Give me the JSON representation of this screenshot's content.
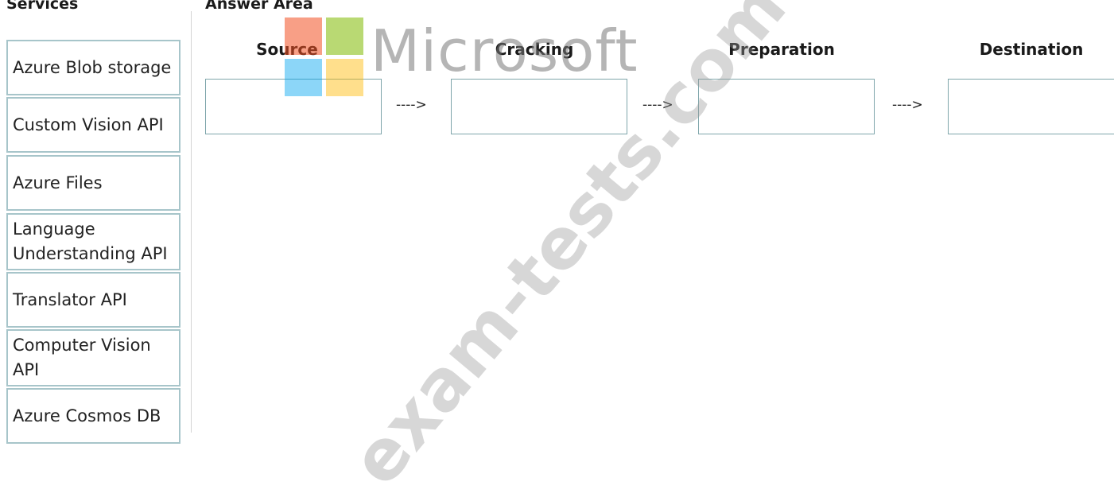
{
  "services": {
    "heading": "Services",
    "items": [
      {
        "label": "Azure Blob storage"
      },
      {
        "label": "Custom Vision API"
      },
      {
        "label": "Azure Files"
      },
      {
        "label": "Language Understanding API"
      },
      {
        "label": "Translator API"
      },
      {
        "label": "Computer Vision API"
      },
      {
        "label": "Azure Cosmos DB"
      }
    ]
  },
  "answer_area": {
    "heading": "Answer Area",
    "stages": [
      {
        "label": "Source"
      },
      {
        "label": "Cracking"
      },
      {
        "label": "Preparation"
      },
      {
        "label": "Destination"
      }
    ],
    "arrow": "---->"
  },
  "watermark": {
    "brand": "Microsoft",
    "site": "exam-tests.com",
    "logo_colors": [
      "#f25022",
      "#7fba00",
      "#00a4ef",
      "#ffb900"
    ]
  }
}
